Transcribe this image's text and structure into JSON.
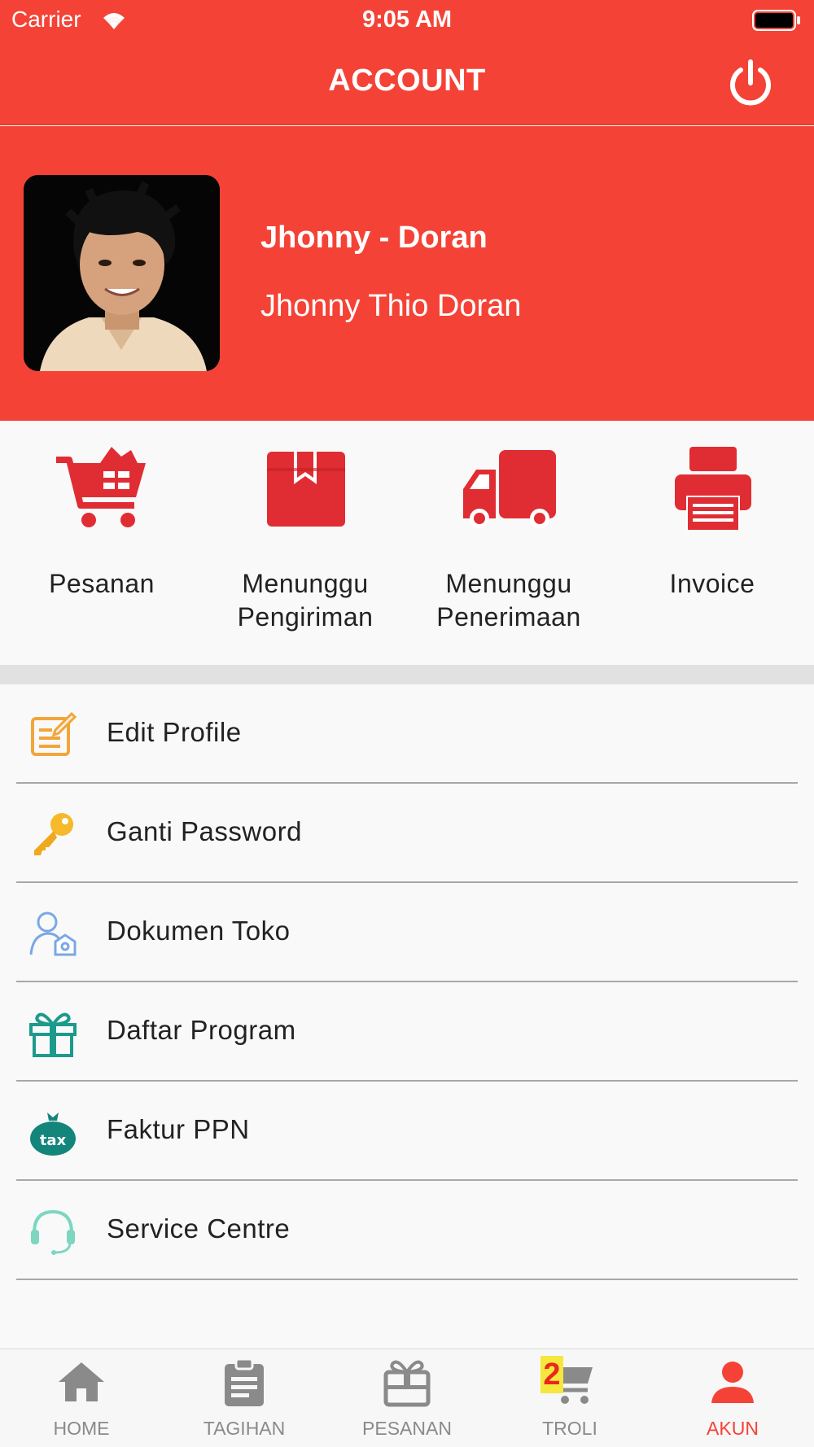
{
  "status_bar": {
    "carrier": "Carrier",
    "time": "9:05 AM"
  },
  "nav": {
    "title": "ACCOUNT",
    "power_icon": "power-icon"
  },
  "profile": {
    "name": "Jhonny - Doran",
    "full_name": "Jhonny Thio Doran"
  },
  "order_status": [
    {
      "icon": "cart-icon",
      "lines": [
        "Pesanan"
      ]
    },
    {
      "icon": "package-icon",
      "lines": [
        "Menunggu",
        "Pengiriman"
      ]
    },
    {
      "icon": "truck-icon",
      "lines": [
        "Menunggu",
        "Penerimaan"
      ]
    },
    {
      "icon": "printer-icon",
      "lines": [
        "Invoice"
      ]
    }
  ],
  "menu": [
    {
      "icon": "edit-icon",
      "label": "Edit Profile"
    },
    {
      "icon": "key-icon",
      "label": "Ganti Password"
    },
    {
      "icon": "user-document-icon",
      "label": "Dokumen Toko"
    },
    {
      "icon": "gift-icon",
      "label": "Daftar Program"
    },
    {
      "icon": "tax-bag-icon",
      "label": "Faktur PPN"
    },
    {
      "icon": "headset-icon",
      "label": "Service Centre"
    }
  ],
  "tabs": [
    {
      "icon": "home-icon",
      "label": "HOME",
      "active": false
    },
    {
      "icon": "clipboard-icon",
      "label": "TAGIHAN",
      "active": false
    },
    {
      "icon": "gift-box-icon",
      "label": "PESANAN",
      "active": false
    },
    {
      "icon": "cart-icon",
      "label": "TROLI",
      "active": false,
      "badge": "2"
    },
    {
      "icon": "person-icon",
      "label": "AKUN",
      "active": true
    }
  ],
  "colors": {
    "brand_red": "#f44336",
    "active_tab": "#f44336",
    "inactive_tab": "#8a8a8a"
  }
}
